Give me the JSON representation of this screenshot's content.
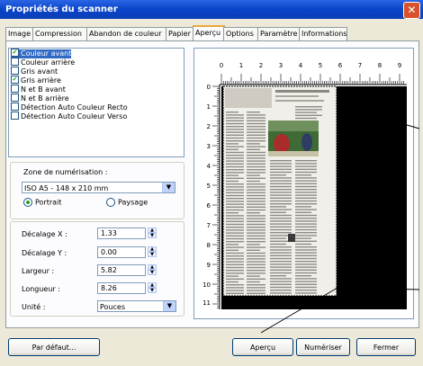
{
  "window": {
    "title": "Propriétés du scanner",
    "close_symbol": "✕"
  },
  "tabs": [
    {
      "label": "Image"
    },
    {
      "label": "Compression"
    },
    {
      "label": "Abandon de couleur"
    },
    {
      "label": "Papier"
    },
    {
      "label": "Aperçu"
    },
    {
      "label": "Options"
    },
    {
      "label": "Paramètre"
    },
    {
      "label": "Informations"
    }
  ],
  "active_tab": "Aperçu",
  "image_list": [
    {
      "label": "Couleur avant",
      "checked": true,
      "selected": true
    },
    {
      "label": "Couleur arrière",
      "checked": false
    },
    {
      "label": "Gris avant",
      "checked": false
    },
    {
      "label": "Gris arrière",
      "checked": true
    },
    {
      "label": "N et B avant",
      "checked": false
    },
    {
      "label": "N et B arrière",
      "checked": false
    },
    {
      "label": "Détection Auto Couleur Recto",
      "checked": false
    },
    {
      "label": "Détection Auto Couleur Verso",
      "checked": false
    }
  ],
  "scan_area": {
    "label": "Zone de numérisation :",
    "value": "ISO A5 - 148 x 210 mm",
    "portrait": "Portrait",
    "landscape": "Paysage",
    "orientation": "Portrait"
  },
  "fields": {
    "offset_x": {
      "label": "Décalage X :",
      "value": "1.33"
    },
    "offset_y": {
      "label": "Décalage Y :",
      "value": "0.00"
    },
    "width": {
      "label": "Largeur :",
      "value": "5.82"
    },
    "length": {
      "label": "Longueur :",
      "value": "8.26"
    },
    "unit": {
      "label": "Unité :",
      "value": "Pouces"
    }
  },
  "ruler": {
    "top": [
      "0",
      "1",
      "2",
      "3",
      "4",
      "5",
      "6",
      "7",
      "8",
      "9"
    ],
    "left": [
      "0",
      "1",
      "2",
      "3",
      "4",
      "5",
      "6",
      "7",
      "8",
      "9",
      "10",
      "11"
    ]
  },
  "buttons": {
    "default": "Par défaut...",
    "preview": "Aperçu",
    "scan": "Numériser",
    "close": "Fermer"
  }
}
